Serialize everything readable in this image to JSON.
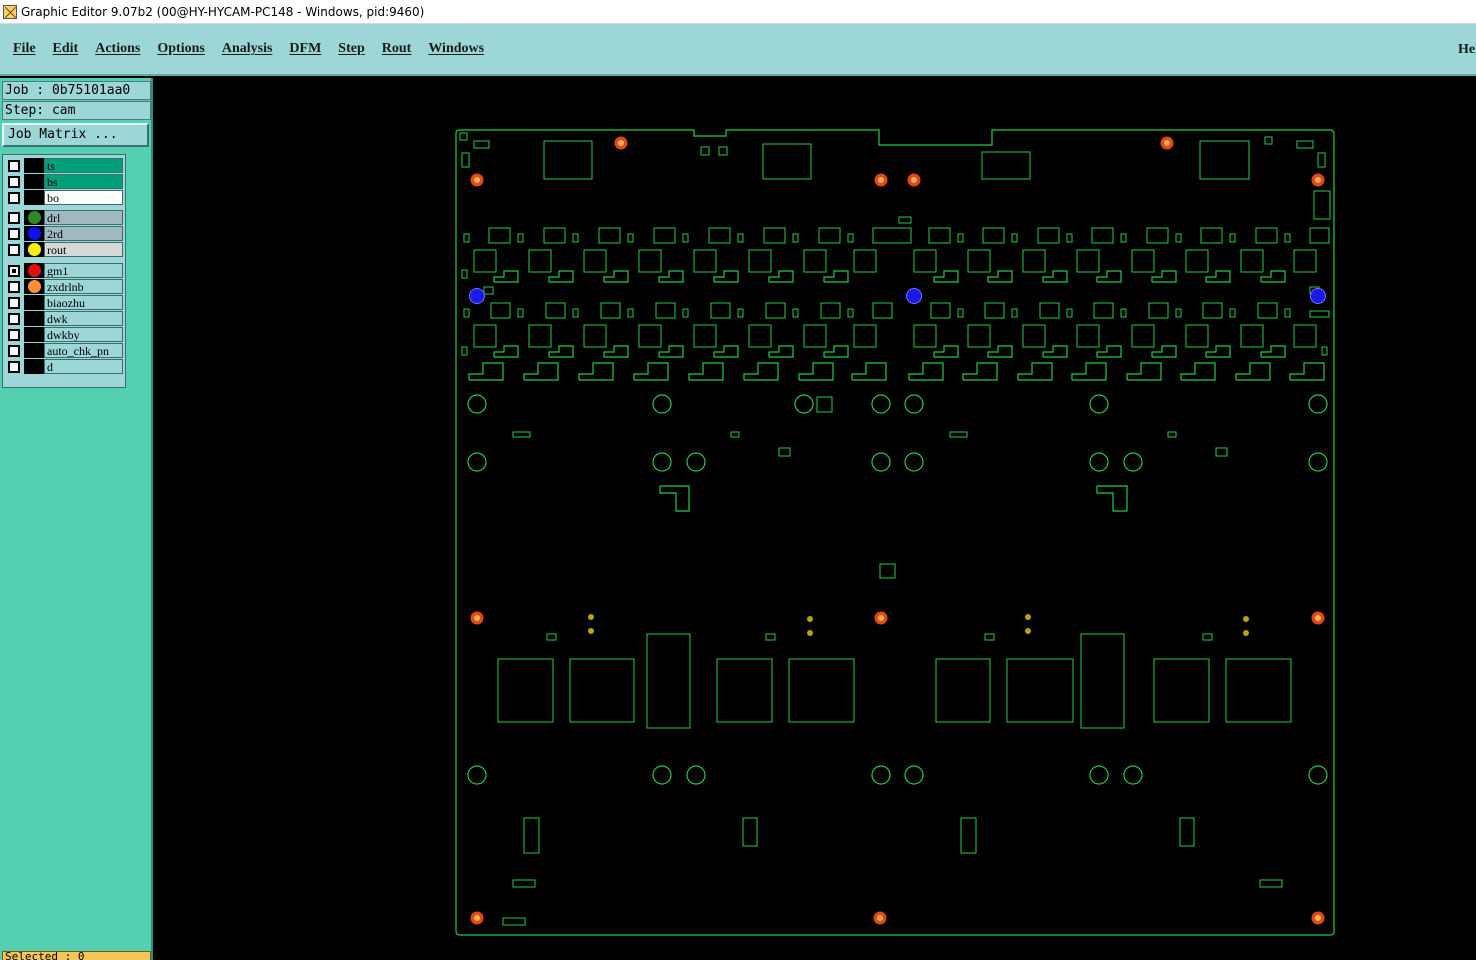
{
  "window": {
    "title": "Graphic Editor 9.07b2 (00@HY-HYCAM-PC148 - Windows, pid:9460)"
  },
  "menu": {
    "items": [
      "File",
      "Edit",
      "Actions",
      "Options",
      "Analysis",
      "DFM",
      "Step",
      "Rout",
      "Windows"
    ],
    "help": "Help"
  },
  "job": {
    "job_line": "Job : 0b75101aa0",
    "step_line": "Step: cam",
    "matrix_button": "Job Matrix ..."
  },
  "layers": [
    {
      "name": "ts",
      "bg": "#00a07a",
      "dot": "",
      "checked": false
    },
    {
      "name": "bs",
      "bg": "#00a07a",
      "dot": "",
      "checked": false
    },
    {
      "name": "bo",
      "bg": "#ffffff",
      "dot": "",
      "checked": false
    },
    {
      "name": "drl",
      "bg": "#a0b8c0",
      "dot": "#2e8b22",
      "checked": false
    },
    {
      "name": "2rd",
      "bg": "#a0b8c0",
      "dot": "#1010f0",
      "checked": false
    },
    {
      "name": "rout",
      "bg": "#d8d8d8",
      "dot": "#ffee00",
      "checked": false
    },
    {
      "name": "gm1",
      "bg": "#9cd6d6",
      "dot": "#e01010",
      "checked": true
    },
    {
      "name": "zxdrlnb",
      "bg": "#9cd6d6",
      "dot": "#ff9030",
      "checked": false
    },
    {
      "name": "biaozhu",
      "bg": "#9cd6d6",
      "dot": "",
      "checked": false
    },
    {
      "name": "dwk",
      "bg": "#9cd6d6",
      "dot": "",
      "checked": false
    },
    {
      "name": "dwkby",
      "bg": "#9cd6d6",
      "dot": "",
      "checked": false
    },
    {
      "name": "auto_chk_pn",
      "bg": "#9cd6d6",
      "dot": "",
      "checked": false
    },
    {
      "name": "d",
      "bg": "#9cd6d6",
      "dot": "",
      "checked": false
    }
  ],
  "status": {
    "selected": "Selected : 0"
  },
  "colors": {
    "outline": "#22cc44",
    "fiducial_outer": "#e04a10",
    "fiducial_inner": "#ffb060",
    "blue_pad": "#1a1ae8",
    "olive_dot": "#b8a400"
  }
}
